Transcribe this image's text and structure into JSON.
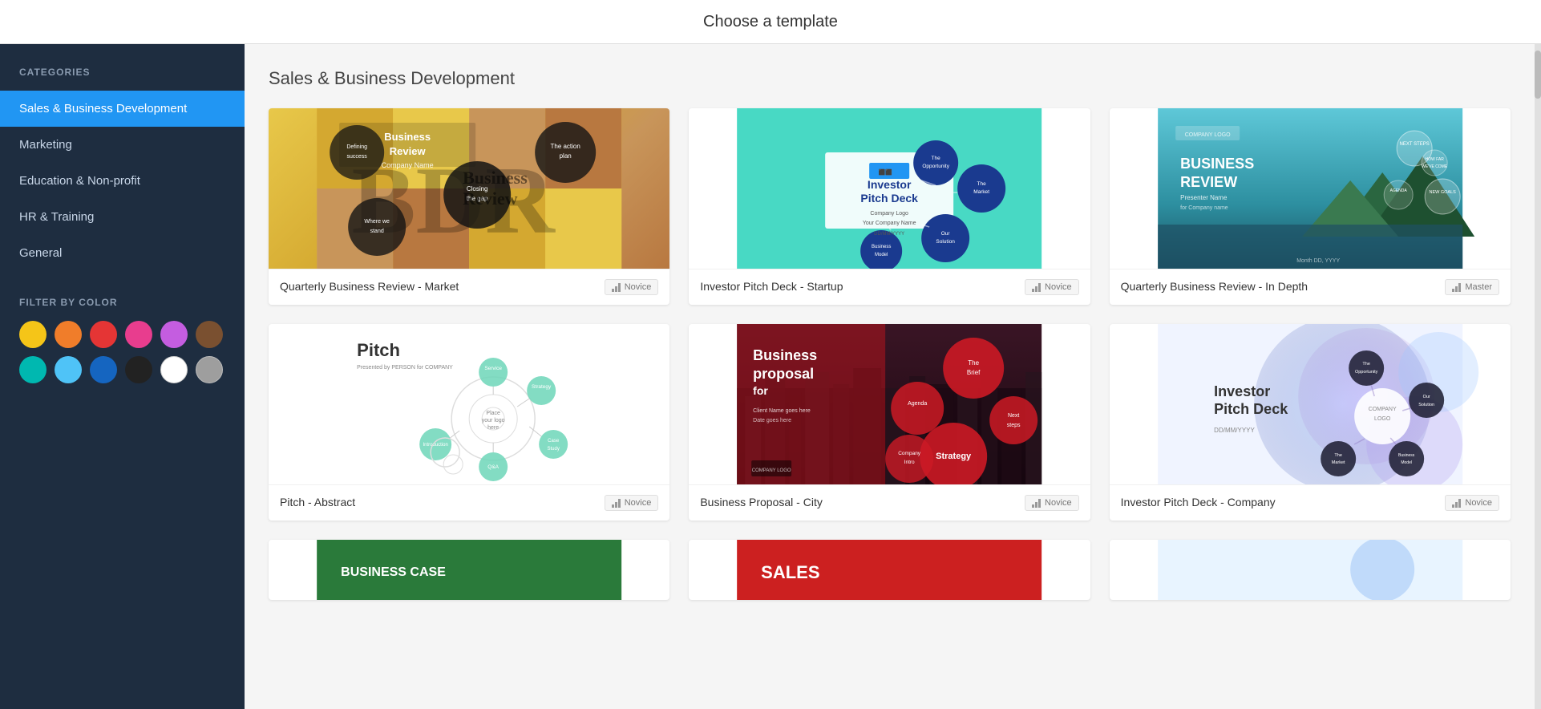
{
  "header": {
    "title": "Choose a template"
  },
  "sidebar": {
    "categories_label": "CATEGORIES",
    "nav_items": [
      {
        "id": "sales",
        "label": "Sales & Business Development",
        "active": true
      },
      {
        "id": "marketing",
        "label": "Marketing",
        "active": false
      },
      {
        "id": "education",
        "label": "Education & Non-profit",
        "active": false
      },
      {
        "id": "hr",
        "label": "HR & Training",
        "active": false
      },
      {
        "id": "general",
        "label": "General",
        "active": false
      }
    ],
    "filter_label": "FILTER BY COLOR",
    "colors": [
      {
        "id": "yellow",
        "hex": "#f5c518",
        "name": "yellow"
      },
      {
        "id": "orange",
        "hex": "#f07d2a",
        "name": "orange"
      },
      {
        "id": "red",
        "hex": "#e53535",
        "name": "red"
      },
      {
        "id": "pink",
        "hex": "#e83d8e",
        "name": "pink"
      },
      {
        "id": "purple",
        "hex": "#c45de0",
        "name": "purple"
      },
      {
        "id": "brown",
        "hex": "#7a5030",
        "name": "brown"
      },
      {
        "id": "teal",
        "hex": "#00b8b0",
        "name": "teal"
      },
      {
        "id": "blue-light",
        "hex": "#4fc3f7",
        "name": "blue-light"
      },
      {
        "id": "blue",
        "hex": "#1565c0",
        "name": "blue"
      },
      {
        "id": "black",
        "hex": "#222222",
        "name": "black"
      },
      {
        "id": "white",
        "hex": "#ffffff",
        "name": "white"
      },
      {
        "id": "gray",
        "hex": "#9e9e9e",
        "name": "gray"
      }
    ]
  },
  "content": {
    "section_title": "Sales & Business Development",
    "templates": [
      {
        "id": "qbr-market",
        "name": "Quarterly Business Review - Market",
        "level": "Novice",
        "thumb_type": "qbr-market"
      },
      {
        "id": "investor-pitch-startup",
        "name": "Investor Pitch Deck - Startup",
        "level": "Novice",
        "thumb_type": "pitch-startup"
      },
      {
        "id": "qbr-indepth",
        "name": "Quarterly Business Review - In Depth",
        "level": "Master",
        "thumb_type": "qbr-indepth"
      },
      {
        "id": "pitch-abstract",
        "name": "Pitch - Abstract",
        "level": "Novice",
        "thumb_type": "pitch-abstract"
      },
      {
        "id": "business-proposal-city",
        "name": "Business Proposal - City",
        "level": "Novice",
        "thumb_type": "business-proposal"
      },
      {
        "id": "investor-pitch-company",
        "name": "Investor Pitch Deck - Company",
        "level": "Novice",
        "thumb_type": "pitch-company"
      }
    ],
    "partial_templates": [
      {
        "id": "business-case",
        "thumb_type": "business-case"
      },
      {
        "id": "sales",
        "thumb_type": "sales"
      },
      {
        "id": "extra",
        "thumb_type": "extra"
      }
    ]
  }
}
